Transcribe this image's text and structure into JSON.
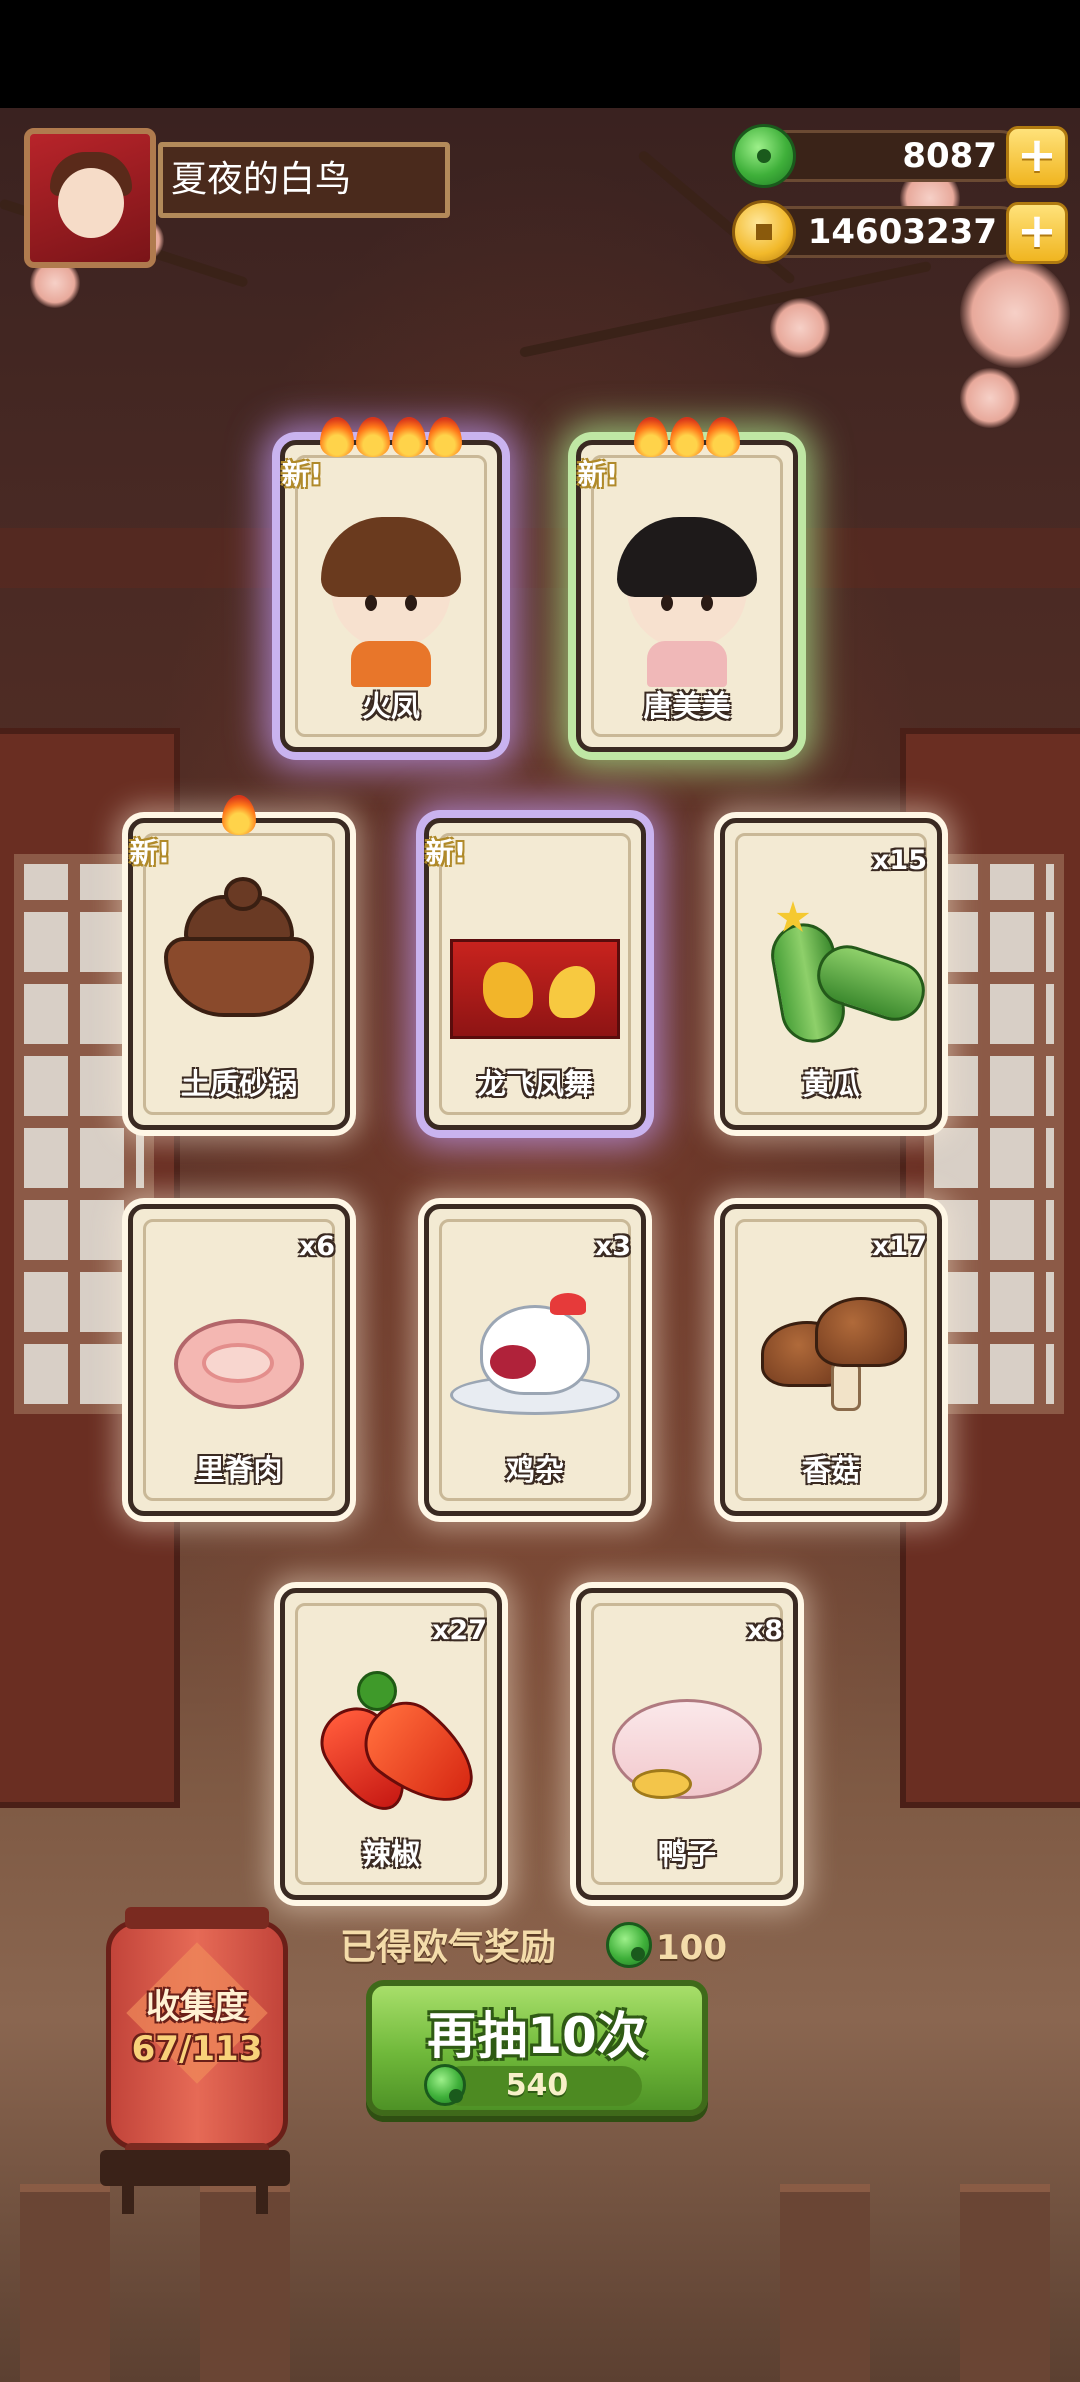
{
  "player": {
    "name": "夏夜的白鸟"
  },
  "resources": {
    "jade": "8087",
    "coins": "14603237",
    "plus_label": "+"
  },
  "new_label": "新",
  "new_mark": "!",
  "cards": [
    {
      "label": "火凤",
      "rarity": "purple",
      "flames": 4,
      "is_new": true
    },
    {
      "label": "唐美美",
      "rarity": "green",
      "flames": 3,
      "is_new": true
    },
    {
      "label": "土质砂锅",
      "rarity": "normal",
      "flames": 1,
      "is_new": true
    },
    {
      "label": "龙飞凤舞",
      "rarity": "purple",
      "flames": 0,
      "is_new": true
    },
    {
      "label": "黄瓜",
      "count": "x15"
    },
    {
      "label": "里脊肉",
      "count": "x6"
    },
    {
      "label": "鸡杂",
      "count": "x3"
    },
    {
      "label": "香菇",
      "count": "x17"
    },
    {
      "label": "辣椒",
      "count": "x27"
    },
    {
      "label": "鸭子",
      "count": "x8"
    }
  ],
  "reward": {
    "label": "已得欧气奖励",
    "value": "100"
  },
  "draw_button": {
    "label": "再抽10次",
    "cost": "540"
  },
  "collection": {
    "label": "收集度",
    "progress": "67/113"
  },
  "colors": {
    "accent_green": "#6fb83a",
    "glow_purple": "#c9b3ef",
    "glow_green": "#bfe7a4",
    "lantern_red": "#e66a56"
  }
}
